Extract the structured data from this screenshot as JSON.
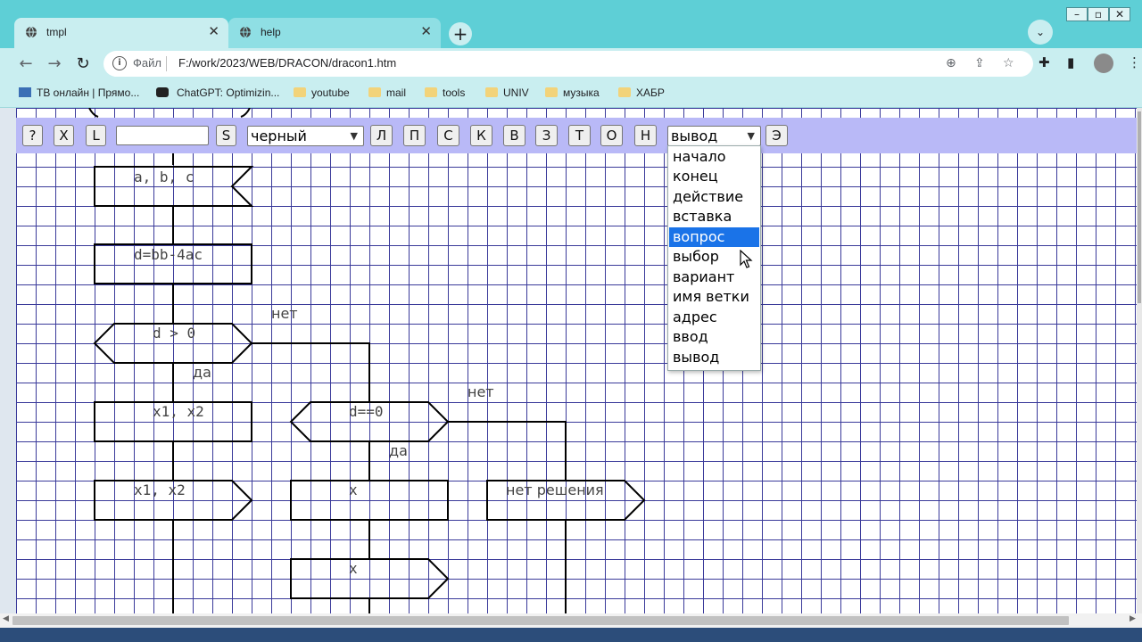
{
  "browser": {
    "tabs": [
      {
        "label": "tmpl",
        "active": true
      },
      {
        "label": "help",
        "active": false
      }
    ],
    "address": {
      "scheme_label": "Файл",
      "url": "F:/work/2023/WEB/DRACON/dracon1.htm"
    },
    "bookmarks": [
      {
        "label": "ТВ онлайн | Прямо...",
        "icon": "tv-icon"
      },
      {
        "label": "ChatGPT: Optimizin...",
        "icon": "chatgpt-icon"
      },
      {
        "label": "youtube",
        "icon": "folder-icon"
      },
      {
        "label": "mail",
        "icon": "folder-icon"
      },
      {
        "label": "tools",
        "icon": "folder-icon"
      },
      {
        "label": "UNIV",
        "icon": "folder-icon"
      },
      {
        "label": "музыка",
        "icon": "folder-icon"
      },
      {
        "label": "ХАБР",
        "icon": "folder-icon"
      }
    ]
  },
  "toolbar": {
    "buttons_left": [
      "?",
      "X",
      "L"
    ],
    "text_input_value": "",
    "s_button": "S",
    "color_select": "черный",
    "letter_buttons": [
      "Л",
      "П",
      "С",
      "К",
      "В",
      "З",
      "Т",
      "О",
      "Н"
    ],
    "shape_select": "вывод",
    "e_button": "Э"
  },
  "dropdown": {
    "options": [
      "начало",
      "конец",
      "действие",
      "вставка",
      "вопрос",
      "выбор",
      "вариант",
      "имя ветки",
      "адрес",
      "ввод",
      "вывод"
    ],
    "highlighted": "вопрос"
  },
  "diagram": {
    "blocks": {
      "input_abc": "a, b, c",
      "disc": "d=bb-4ac",
      "cond1": "d > 0",
      "x1x2_calc": "x1, x2",
      "x1x2_out": "x1, x2",
      "cond2": "d==0",
      "x_calc": "x",
      "x_out": "x",
      "no_solution": "нет решения"
    },
    "labels": {
      "no1": "нет",
      "yes1": "да",
      "no2": "нет",
      "yes2": "да"
    }
  }
}
